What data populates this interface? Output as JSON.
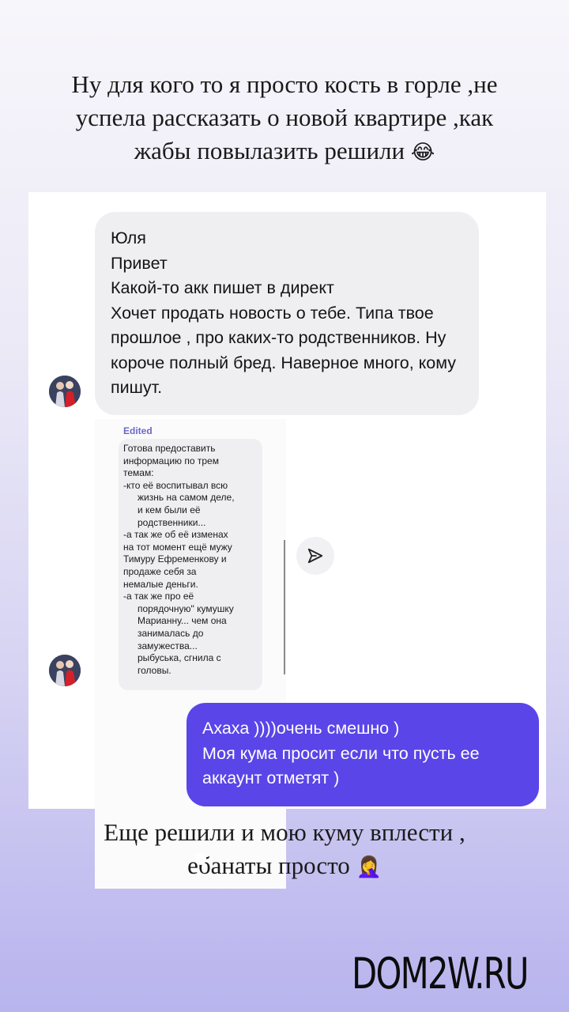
{
  "story": {
    "caption_top": {
      "lines": [
        "Ну для кого то я просто кость в горле ,не",
        "успела рассказать о новой квартире ,как",
        "жабы повылазить решили"
      ],
      "emoji": "😂"
    },
    "caption_bottom": {
      "lines": [
        "Еще решили и мою куму вплести ,",
        "ебанаты просто"
      ],
      "emoji": "🤦‍♀️"
    },
    "watermark": "DOM2W.RU"
  },
  "chat": {
    "incoming_message": {
      "lines": [
        "Юля",
        "Привет",
        "Какой-то акк пишет в директ",
        "Хочет продать новость о тебе. Типа твое прошлое , про каких-то родственников. Ну короче полный бред. Наверное много, кому пишут."
      ]
    },
    "forwarded_screenshot": {
      "edited_label": "Edited",
      "lines": [
        "Готова предоставить",
        "информацию по трем",
        "темам:",
        "-кто её воспитывал всю",
        "жизнь на самом деле,",
        "и кем были её",
        "родственники...",
        "-а так же об её изменах",
        "на тот момент ещё мужу",
        "Тимуру Ефременкову и",
        "продаже себя за",
        "немалые деньги.",
        "-а так же про её",
        "порядочную\" кумушку",
        "Марианну... чем она",
        "занималась до",
        "замужества...",
        "рыбуська, сгнила с",
        "головы."
      ]
    },
    "share_icon": "send-icon",
    "outgoing_message": {
      "lines": [
        "Ахаха ))))очень смешно )",
        "Моя кума просит если что пусть ее аккаунт отметят )"
      ]
    },
    "colors": {
      "outgoing_bubble": "#5a45e8",
      "incoming_bubble": "#efeff2",
      "edited_label": "#6d68c8"
    }
  }
}
